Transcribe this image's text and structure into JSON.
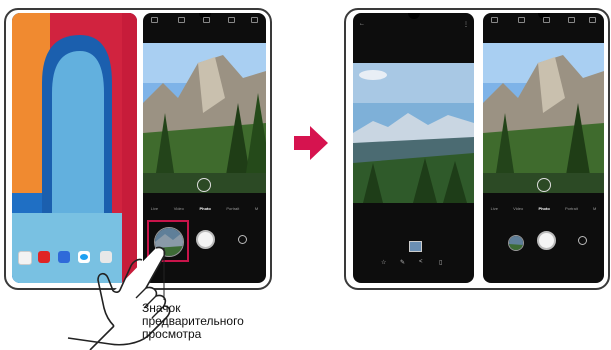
{
  "camera": {
    "tabs": [
      "Live",
      "Video",
      "Photo",
      "Portrait",
      "M"
    ],
    "active_tab": "Photo"
  },
  "callout": {
    "line1": "Значок",
    "line2": "предварительного",
    "line3": "просмотра"
  },
  "colors": {
    "arrow": "#d6134f",
    "phone_border": "#3a3a3a",
    "highlight_box": "#c8144a"
  },
  "icons": {
    "arrow": "right-arrow-icon",
    "hand": "hand-pointer-icon",
    "gallery_star": "star-icon",
    "gallery_edit": "pencil-icon",
    "gallery_share": "share-icon",
    "gallery_delete": "trash-icon"
  }
}
